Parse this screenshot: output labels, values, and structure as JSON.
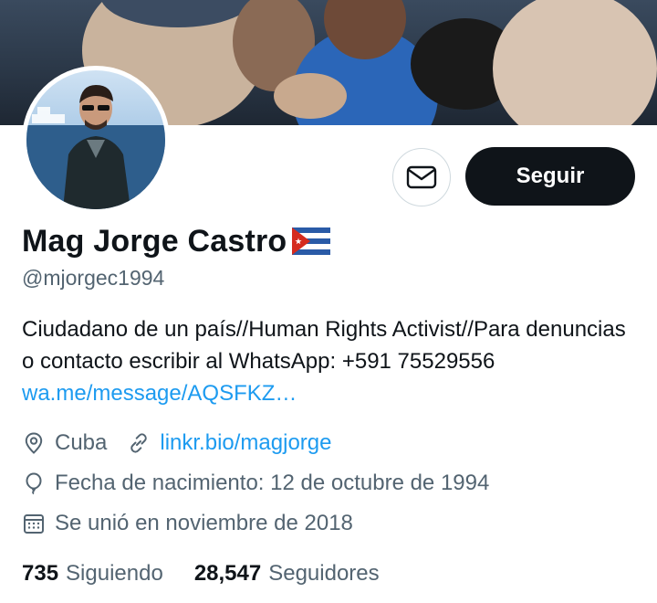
{
  "profile": {
    "name": "Mag Jorge Castro",
    "handle": "@mjorgec1994",
    "bio_text": "Ciudadano de un país//Human Rights Activist//Para denuncias o contacto escribir al WhatsApp: +591 75529556 ",
    "bio_link": "wa.me/message/AQSFKZ…",
    "location": "Cuba",
    "website": "linkr.bio/magjorge",
    "birthday": "Fecha de nacimiento: 12 de octubre de 1994",
    "joined": "Se unió en noviembre de 2018"
  },
  "actions": {
    "follow_label": "Seguir",
    "message_icon": "envelope-icon"
  },
  "stats": {
    "following_count": "735",
    "following_label": "Siguiendo",
    "followers_count": "28,547",
    "followers_label": "Seguidores"
  },
  "colors": {
    "link": "#1d9bf0",
    "text_primary": "#0f1419",
    "text_secondary": "#536471",
    "button_dark": "#0f1419"
  },
  "icons": {
    "location": "location-pin-icon",
    "website": "link-icon",
    "birthday": "balloon-icon",
    "joined": "calendar-icon",
    "flag": "cuba-flag-icon"
  }
}
